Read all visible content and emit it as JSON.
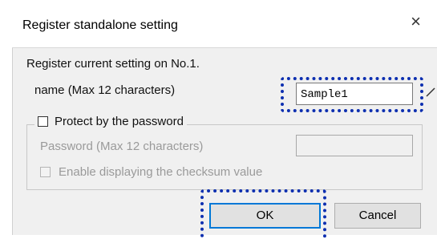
{
  "dialog": {
    "title": "Register standalone setting",
    "close_glyph": "×",
    "message": "Register current setting on No.1.",
    "name_label": "name (Max 12 characters)",
    "name_value": "Sample1",
    "protect_label": "Protect by the password",
    "password_label": "Password (Max 12 characters)",
    "checksum_label": "Enable displaying the checksum value",
    "ok_label": "OK",
    "cancel_label": "Cancel"
  },
  "colors": {
    "highlight": "#0d2fb0",
    "focus": "#0078d7",
    "panel": "#f0f0f0"
  }
}
